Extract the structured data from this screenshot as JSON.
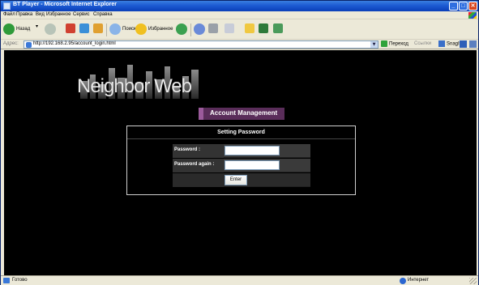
{
  "window": {
    "title": "BT Player - Microsoft Internet Explorer",
    "buttons": {
      "minimize": "_",
      "maximize": "□",
      "close": "✕"
    }
  },
  "menu": [
    "Файл",
    "Правка",
    "Вид",
    "Избранное",
    "Сервис",
    "Справка"
  ],
  "toolbar": {
    "back": "Назад",
    "search": "Поиск",
    "favorites": "Избранное"
  },
  "address": {
    "label": "Адрес:",
    "url": "http://192.168.2.95/account_login.html",
    "go": "Переход",
    "links": "Ссылки",
    "snagit": "SnagIt"
  },
  "page": {
    "logo_text": "Neighbor Web",
    "section_header": "Account Management",
    "panel_title": "Setting Password",
    "fields": [
      {
        "label": "Password :",
        "value": ""
      },
      {
        "label": "Password again :",
        "value": ""
      }
    ],
    "submit_label": "Enter"
  },
  "status": {
    "text": "Готово",
    "zone": "Интернет"
  },
  "colors": {
    "titlebar": "#1c5ad2",
    "content_bg": "#000000",
    "header_bg": "#5a2d5a",
    "header_accent": "#9b5a9b"
  }
}
